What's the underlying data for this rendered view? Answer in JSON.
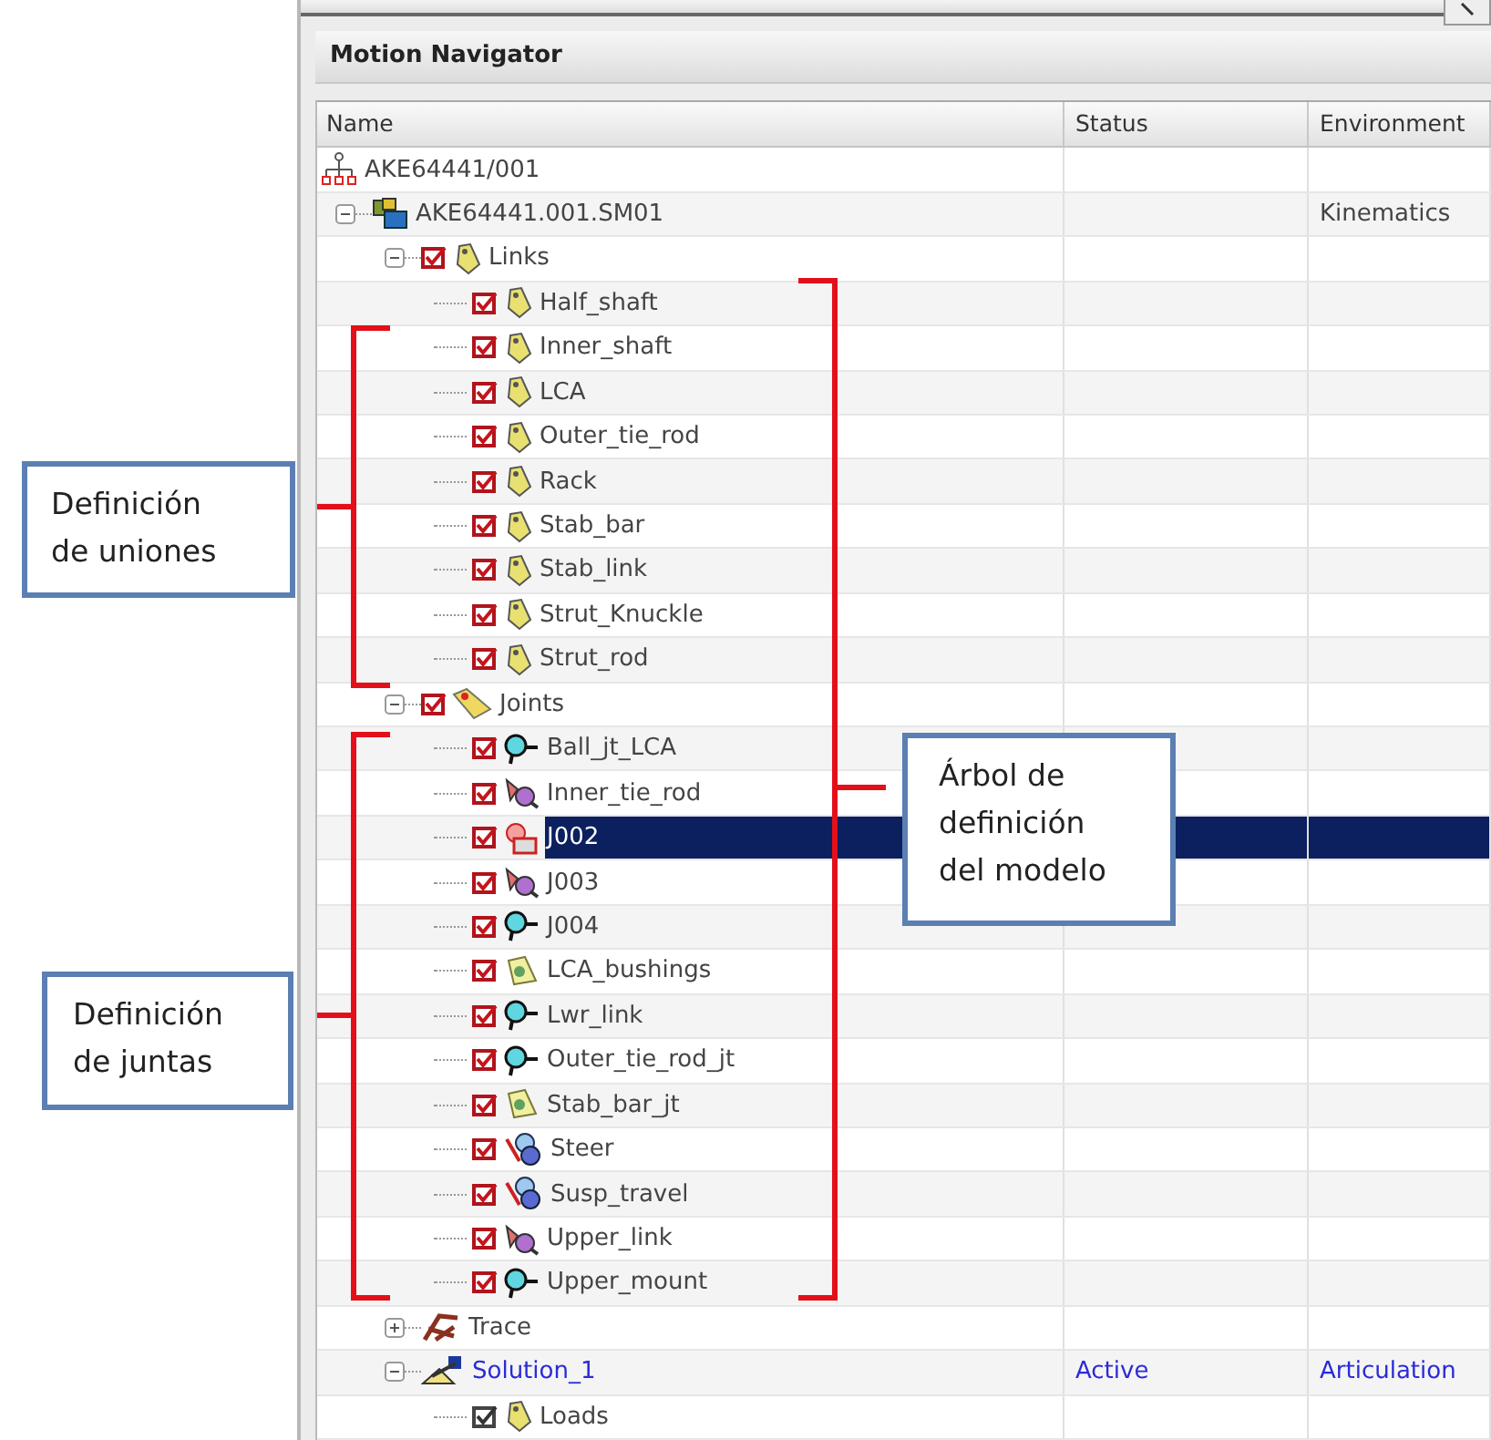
{
  "panel": {
    "title": "Motion Navigator"
  },
  "columns": [
    "Name",
    "Status",
    "Environment"
  ],
  "tree": [
    {
      "name": "AKE64441/001",
      "kind": "assembly",
      "selected": false,
      "children": [
        {
          "name": "AKE64441.001.SM01",
          "kind": "subassembly",
          "environment": "Kinematics",
          "expanded": true,
          "selected": false,
          "children": [
            {
              "name": "Links",
              "kind": "links",
              "checked": true,
              "expanded": true,
              "selected": false,
              "children": [
                {
                  "name": "Half_shaft",
                  "kind": "link",
                  "checked": true,
                  "selected": false
                },
                {
                  "name": "Inner_shaft",
                  "kind": "link",
                  "checked": true,
                  "selected": false
                },
                {
                  "name": "LCA",
                  "kind": "link",
                  "checked": true,
                  "selected": false
                },
                {
                  "name": "Outer_tie_rod",
                  "kind": "link",
                  "checked": true,
                  "selected": false
                },
                {
                  "name": "Rack",
                  "kind": "link",
                  "checked": true,
                  "selected": false
                },
                {
                  "name": "Stab_bar",
                  "kind": "link",
                  "checked": true,
                  "selected": false
                },
                {
                  "name": "Stab_link",
                  "kind": "link",
                  "checked": true,
                  "selected": false
                },
                {
                  "name": "Strut_Knuckle",
                  "kind": "link",
                  "checked": true,
                  "selected": false
                },
                {
                  "name": "Strut_rod",
                  "kind": "link",
                  "checked": true,
                  "selected": false
                }
              ]
            },
            {
              "name": "Joints",
              "kind": "joints",
              "checked": true,
              "expanded": true,
              "selected": false,
              "children": [
                {
                  "name": "Ball_jt_LCA",
                  "kind": "ball",
                  "checked": true,
                  "selected": false
                },
                {
                  "name": "Inner_tie_rod",
                  "kind": "universal",
                  "checked": true,
                  "selected": false
                },
                {
                  "name": "J002",
                  "kind": "gear",
                  "checked": true,
                  "selected": true
                },
                {
                  "name": "J003",
                  "kind": "universal",
                  "checked": true,
                  "selected": false
                },
                {
                  "name": "J004",
                  "kind": "ball",
                  "checked": true,
                  "selected": false
                },
                {
                  "name": "LCA_bushings",
                  "kind": "bushing",
                  "checked": true,
                  "selected": false
                },
                {
                  "name": "Lwr_link",
                  "kind": "ball",
                  "checked": true,
                  "selected": false
                },
                {
                  "name": "Outer_tie_rod_jt",
                  "kind": "ball",
                  "checked": true,
                  "selected": false
                },
                {
                  "name": "Stab_bar_jt",
                  "kind": "bushing",
                  "checked": true,
                  "selected": false
                },
                {
                  "name": "Steer",
                  "kind": "driver",
                  "checked": true,
                  "selected": false
                },
                {
                  "name": "Susp_travel",
                  "kind": "driver",
                  "checked": true,
                  "selected": false
                },
                {
                  "name": "Upper_link",
                  "kind": "universal",
                  "checked": true,
                  "selected": false
                },
                {
                  "name": "Upper_mount",
                  "kind": "ball",
                  "checked": true,
                  "selected": false
                }
              ]
            },
            {
              "name": "Trace",
              "kind": "trace",
              "expanded": false,
              "selected": false
            },
            {
              "name": "Solution_1",
              "kind": "solution",
              "status": "Active",
              "environment": "Articulation",
              "active": true,
              "expanded": true,
              "selected": false,
              "children": [
                {
                  "name": "Loads",
                  "kind": "link",
                  "checked": true,
                  "enabled": false,
                  "selected": false
                }
              ]
            }
          ]
        }
      ]
    }
  ],
  "annotations": [
    {
      "lines": [
        "Definición",
        "de uniones"
      ]
    },
    {
      "lines": [
        "Definición",
        "de juntas"
      ]
    },
    {
      "lines": [
        "Árbol de",
        "definición",
        "del modelo"
      ]
    }
  ]
}
